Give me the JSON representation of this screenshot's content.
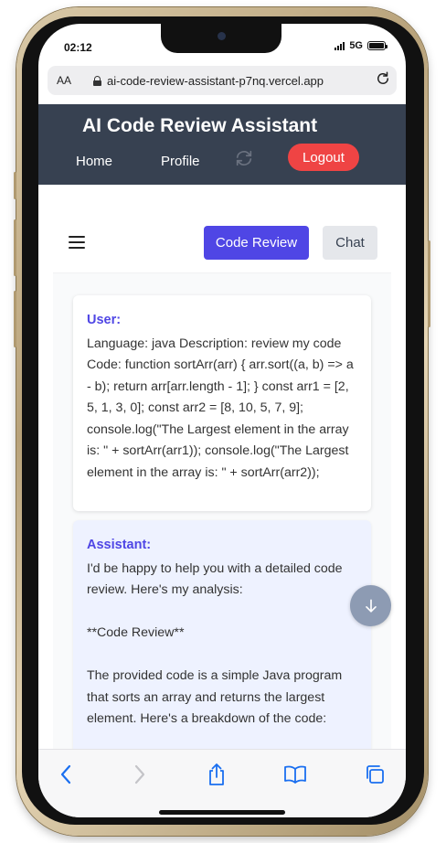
{
  "status_bar": {
    "time": "02:12",
    "network": "5G"
  },
  "browser": {
    "text_size_label": "AA",
    "url": "ai-code-review-assistant-p7nq.vercel.app"
  },
  "header": {
    "title": "AI Code Review Assistant",
    "nav": {
      "home": "Home",
      "profile": "Profile",
      "logout": "Logout"
    }
  },
  "toolbar": {
    "code_review_label": "Code Review",
    "chat_label": "Chat"
  },
  "messages": [
    {
      "role": "User:",
      "text": "Language: java Description: review my code Code: function sortArr(arr) { arr.sort((a, b) => a - b); return arr[arr.length - 1]; } const arr1 = [2, 5, 1, 3, 0]; const arr2 = [8, 10, 5, 7, 9]; console.log(\"The Largest element in the array is: \" + sortArr(arr1)); console.log(\"The Largest element in the array is: \" + sortArr(arr2));"
    },
    {
      "role": "Assistant:",
      "paragraphs": [
        "I'd be happy to help you with a detailed code review. Here's my analysis:",
        "**Code Review**",
        "The provided code is a simple Java program that sorts an array and returns the largest element. Here's a breakdown of the code:"
      ]
    }
  ],
  "colors": {
    "header_bg": "#374151",
    "primary": "#4f46e5",
    "logout": "#ef4444",
    "assistant_bg": "#eef2ff"
  },
  "icons": {
    "menu": "hamburger-icon",
    "refresh": "refresh-icon",
    "scroll": "arrow-down-icon",
    "back": "chevron-left-icon",
    "forward": "chevron-right-icon",
    "share": "share-icon",
    "bookmarks": "book-icon",
    "tabs": "tabs-icon"
  }
}
